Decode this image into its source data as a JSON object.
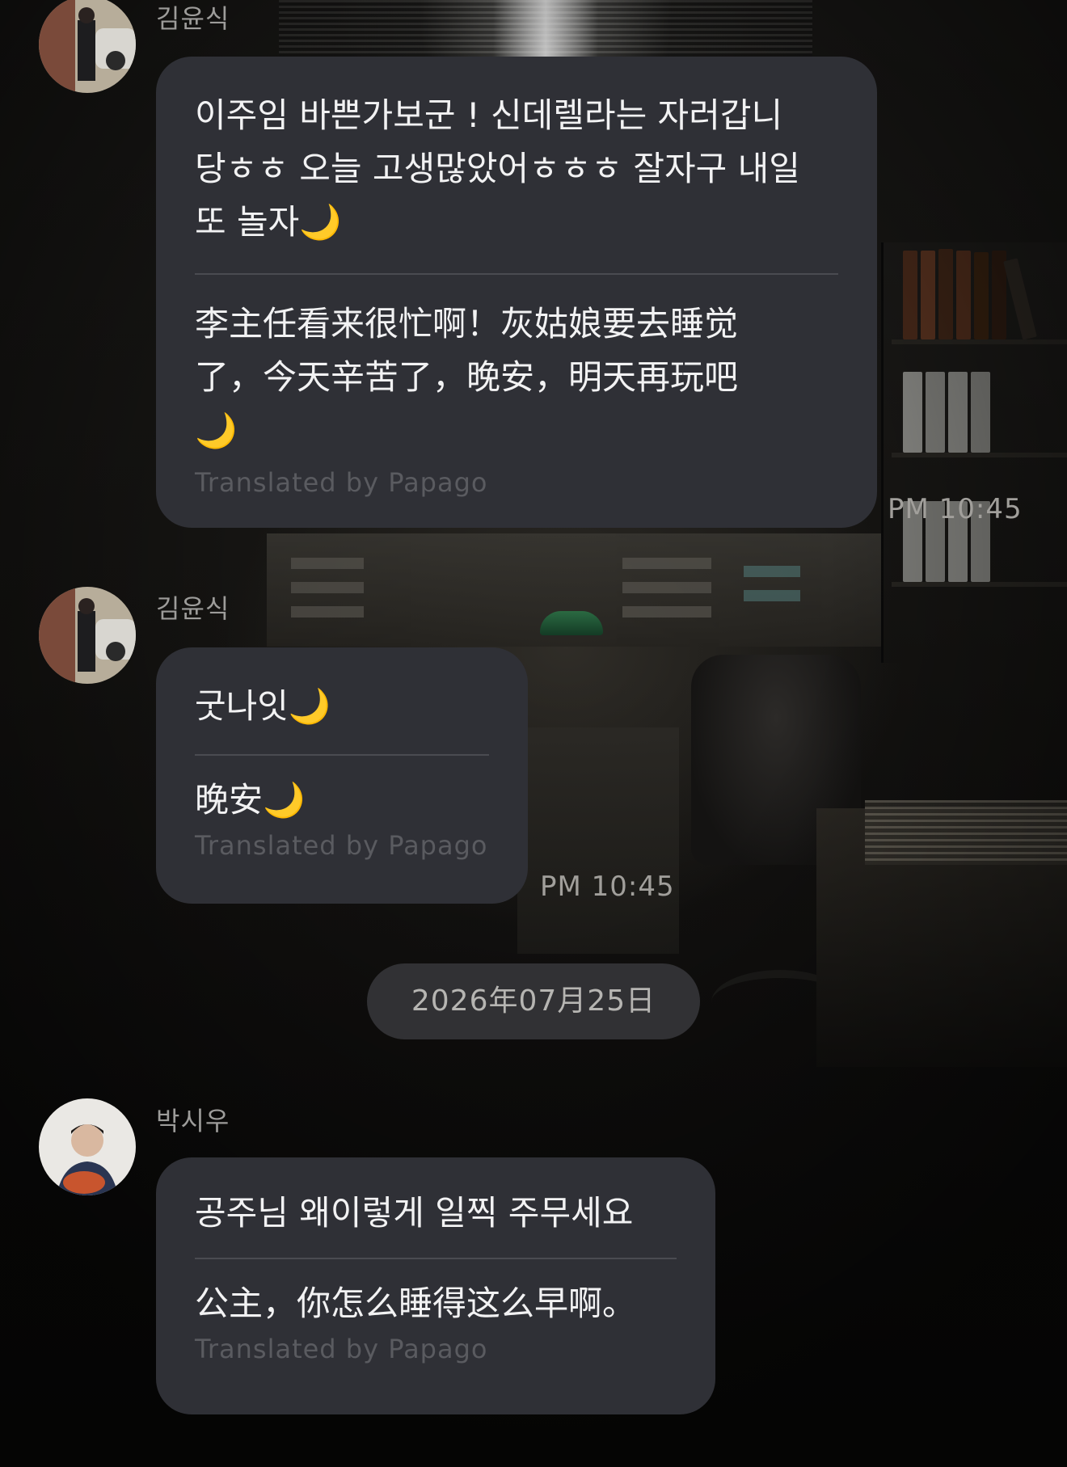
{
  "messages": [
    {
      "sender": "김윤식",
      "original": "이주임 바쁜가보군 ! 신데렐라는 자러갑니\n당ㅎㅎ 오늘 고생많았어ㅎㅎㅎ 잘자구 내일\n또 놀자🌙",
      "translation": "李主任看来很忙啊！灰姑娘要去睡觉\n了，今天辛苦了，晚安，明天再玩吧\n🌙",
      "translated_by": "Translated by Papago",
      "time": "PM 10:45"
    },
    {
      "sender": "김윤식",
      "original": "굿나잇🌙",
      "translation": "晚安🌙",
      "translated_by": "Translated by Papago",
      "time": "PM 10:45"
    },
    {
      "sender": "박시우",
      "original": "공주님 왜이렇게 일찍 주무세요",
      "translation": "公主，你怎么睡得这么早啊。",
      "translated_by": "Translated by Papago"
    }
  ],
  "date_separator": "2026年07月25日",
  "colors": {
    "bubble": "#2f3036",
    "text": "#f2f2f3",
    "muted": "#5a5b60",
    "sender": "#9d9c9a"
  }
}
